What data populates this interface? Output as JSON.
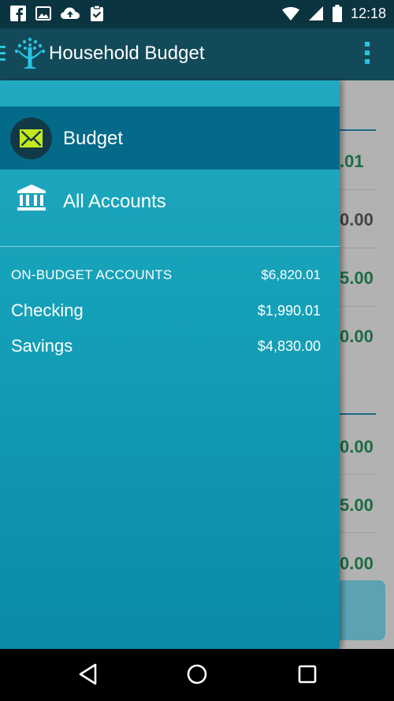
{
  "status_bar": {
    "time": "12:18",
    "icons": [
      "facebook-icon",
      "gallery-icon",
      "cloud-upload-icon",
      "clipboard-check-icon",
      "wifi-icon",
      "cell-signal-icon",
      "battery-icon"
    ]
  },
  "app_bar": {
    "title": "Household Budget",
    "icons": [
      "hamburger-icon",
      "tree-logo-icon",
      "overflow-menu-icon"
    ]
  },
  "drawer": {
    "items": [
      {
        "label": "Budget",
        "icon": "envelope-icon",
        "selected": true
      },
      {
        "label": "All Accounts",
        "icon": "bank-icon",
        "selected": false
      }
    ],
    "section": {
      "label": "ON-BUDGET ACCOUNTS",
      "total": "$6,820.01",
      "accounts": [
        {
          "name": "Checking",
          "balance": "$1,990.01"
        },
        {
          "name": "Savings",
          "balance": "$4,830.00"
        }
      ]
    }
  },
  "background_amounts": [
    ".01",
    "0.00",
    "5.00",
    "0.00",
    "0.00",
    "5.00",
    "0.00"
  ],
  "nav_bar": {
    "icons": [
      "back-icon",
      "home-icon",
      "recents-icon"
    ]
  },
  "colors": {
    "status_bar": "#0b3441",
    "app_bar": "#134a59",
    "drawer_top": "#21aabf",
    "drawer_bottom": "#0b8aa8",
    "drawer_selected": "#046a8a",
    "budget_icon_accent": "#c6e81e",
    "amount_green": "#1e6b43"
  }
}
